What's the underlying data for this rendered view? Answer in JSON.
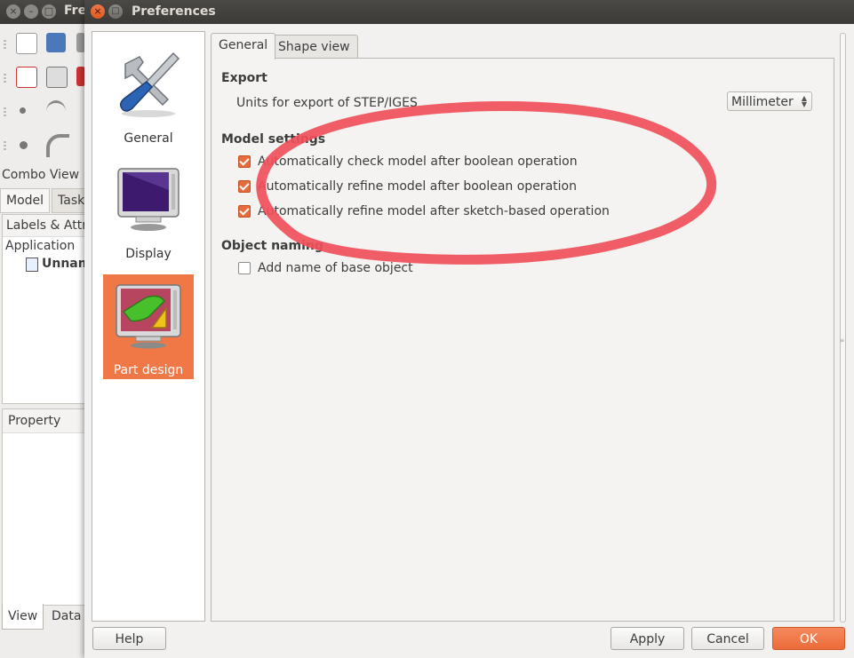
{
  "background_window": {
    "title": "Fre",
    "combo_view_label": "Combo View",
    "tabs": [
      "Model",
      "Task"
    ],
    "tree_header": "Labels & Attri",
    "tree_app": "Application",
    "tree_document": "Unnam",
    "property_header": "Property",
    "bottom_tabs": [
      "View",
      "Data"
    ]
  },
  "dialog": {
    "title": "Preferences",
    "pages": [
      {
        "label": "General",
        "icon": "tools-icon",
        "selected": false
      },
      {
        "label": "Display",
        "icon": "monitor-icon",
        "selected": false
      },
      {
        "label": "Part design",
        "icon": "part-design-icon",
        "selected": true
      }
    ],
    "tabs": [
      {
        "label": "General",
        "active": true
      },
      {
        "label": "Shape view",
        "active": false
      }
    ],
    "export": {
      "title": "Export",
      "units_label": "Units for export of STEP/IGES",
      "units_value": "Millimeter"
    },
    "model_settings": {
      "title": "Model settings",
      "options": [
        {
          "label": "Automatically check model after boolean operation",
          "checked": true
        },
        {
          "label": "Automatically refine model after boolean operation",
          "checked": true
        },
        {
          "label": "Automatically refine model after sketch-based operation",
          "checked": true
        }
      ]
    },
    "object_naming": {
      "title": "Object naming",
      "options": [
        {
          "label": "Add name of base object",
          "checked": false
        }
      ]
    },
    "buttons": {
      "help": "Help",
      "apply": "Apply",
      "cancel": "Cancel",
      "ok": "OK"
    }
  },
  "colors": {
    "accent": "#f07746",
    "annotation_ellipse": "#f0505a",
    "titlebar": "#3b3a36"
  }
}
